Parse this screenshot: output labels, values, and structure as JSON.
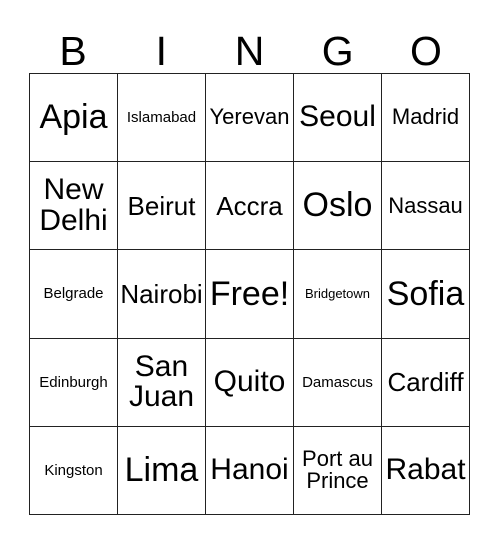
{
  "card": {
    "title": "BINGO card",
    "headers": [
      "B",
      "I",
      "N",
      "G",
      "O"
    ],
    "free_space": "Free!",
    "rows": [
      [
        {
          "label": "Apia",
          "size": "fs-xl"
        },
        {
          "label": "Islamabad",
          "size": "fs-xs"
        },
        {
          "label": "Yerevan",
          "size": "fs-sm"
        },
        {
          "label": "Seoul",
          "size": "fs-lg"
        },
        {
          "label": "Madrid",
          "size": "fs-sm"
        }
      ],
      [
        {
          "label": "New\nDelhi",
          "size": "fs-lg"
        },
        {
          "label": "Beirut",
          "size": "fs-md"
        },
        {
          "label": "Accra",
          "size": "fs-md"
        },
        {
          "label": "Oslo",
          "size": "fs-xl"
        },
        {
          "label": "Nassau",
          "size": "fs-sm"
        }
      ],
      [
        {
          "label": "Belgrade",
          "size": "fs-xs"
        },
        {
          "label": "Nairobi",
          "size": "fs-md"
        },
        {
          "label": "Free!",
          "size": "fs-xl"
        },
        {
          "label": "Bridgetown",
          "size": "fs-xxs"
        },
        {
          "label": "Sofia",
          "size": "fs-xl"
        }
      ],
      [
        {
          "label": "Edinburgh",
          "size": "fs-xs"
        },
        {
          "label": "San\nJuan",
          "size": "fs-lg"
        },
        {
          "label": "Quito",
          "size": "fs-lg"
        },
        {
          "label": "Damascus",
          "size": "fs-xs"
        },
        {
          "label": "Cardiff",
          "size": "fs-md"
        }
      ],
      [
        {
          "label": "Kingston",
          "size": "fs-xs"
        },
        {
          "label": "Lima",
          "size": "fs-xl"
        },
        {
          "label": "Hanoi",
          "size": "fs-lg"
        },
        {
          "label": "Port au\nPrince",
          "size": "fs-sm"
        },
        {
          "label": "Rabat",
          "size": "fs-lg"
        }
      ]
    ]
  },
  "colors": {
    "border": "#222222",
    "text": "#000000",
    "background": "#ffffff"
  }
}
